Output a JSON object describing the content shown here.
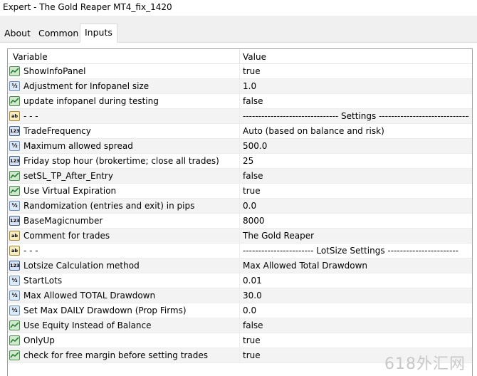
{
  "window": {
    "title": "Expert - The Gold Reaper MT4_fix_1420"
  },
  "tabs": [
    {
      "label": "About"
    },
    {
      "label": "Common"
    },
    {
      "label": "Inputs"
    }
  ],
  "grid": {
    "col_variable": "Variable",
    "col_value": "Value",
    "rows": [
      {
        "type": "bool",
        "icon": "bool-icon",
        "name": "ShowInfoPanel",
        "value": "true"
      },
      {
        "type": "double",
        "icon": "double-icon",
        "name": "Adjustment for Infopanel size",
        "value": "1.0"
      },
      {
        "type": "bool",
        "icon": "bool-icon",
        "name": "update infopanel during testing",
        "value": "false"
      },
      {
        "type": "string",
        "icon": "string-icon",
        "name": "- - -",
        "value": "------------------------------- Settings ------------------------------"
      },
      {
        "type": "int",
        "icon": "int-icon",
        "name": "TradeFrequency",
        "value": "Auto (based on balance and risk)"
      },
      {
        "type": "double",
        "icon": "double-icon",
        "name": "Maximum allowed spread",
        "value": "500.0"
      },
      {
        "type": "int",
        "icon": "int-icon",
        "name": "Friday stop hour (brokertime; close all trades)",
        "value": "25"
      },
      {
        "type": "bool",
        "icon": "bool-icon",
        "name": "setSL_TP_After_Entry",
        "value": "false"
      },
      {
        "type": "bool",
        "icon": "bool-icon",
        "name": "Use Virtual Expiration",
        "value": "true"
      },
      {
        "type": "double",
        "icon": "double-icon",
        "name": "Randomization (entries and exit) in pips",
        "value": "0.0"
      },
      {
        "type": "int",
        "icon": "int-icon",
        "name": "BaseMagicnumber",
        "value": "8000"
      },
      {
        "type": "string",
        "icon": "string-icon",
        "name": "Comment for trades",
        "value": "The Gold Reaper"
      },
      {
        "type": "string",
        "icon": "string-icon",
        "name": "- - -",
        "value": "----------------------- LotSize Settings -----------------------"
      },
      {
        "type": "int",
        "icon": "int-icon",
        "name": "Lotsize Calculation method",
        "value": "Max Allowed Total Drawdown"
      },
      {
        "type": "double",
        "icon": "double-icon",
        "name": "StartLots",
        "value": "0.01"
      },
      {
        "type": "double",
        "icon": "double-icon",
        "name": "Max Allowed TOTAL Drawdown",
        "value": "30.0"
      },
      {
        "type": "double",
        "icon": "double-icon",
        "name": "Set Max DAILY Drawdown (Prop Firms)",
        "value": "0.0"
      },
      {
        "type": "bool",
        "icon": "bool-icon",
        "name": "Use Equity Instead of Balance",
        "value": "false"
      },
      {
        "type": "bool",
        "icon": "bool-icon",
        "name": "OnlyUp",
        "value": "true"
      },
      {
        "type": "bool",
        "icon": "bool-icon",
        "name": "check for free margin before setting trades",
        "value": "true"
      }
    ]
  },
  "watermark": {
    "text": "618外汇网"
  }
}
